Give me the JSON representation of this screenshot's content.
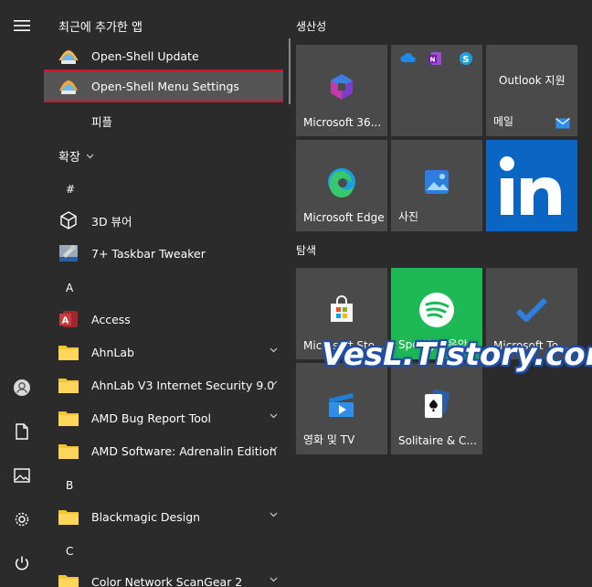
{
  "recent": {
    "header": "최근에 추가한 앱",
    "items": [
      {
        "label": "Open-Shell Update"
      },
      {
        "label": "Open-Shell Menu Settings"
      },
      {
        "label": "피플"
      }
    ]
  },
  "expand_label": "확장",
  "letters": {
    "hash": "#",
    "a": "A",
    "b": "B",
    "c": "C"
  },
  "apps": [
    {
      "label": "3D 뷰어"
    },
    {
      "label": "7+ Taskbar Tweaker"
    },
    {
      "label": "Access"
    },
    {
      "label": "AhnLab"
    },
    {
      "label": "AhnLab V3 Internet Security 9.0"
    },
    {
      "label": "AMD Bug Report Tool"
    },
    {
      "label": "AMD Software: Adrenalin Edition"
    },
    {
      "label": "Blackmagic Design"
    },
    {
      "label": "Color Network ScanGear 2"
    }
  ],
  "groups": {
    "productivity": "생산성",
    "explore": "탐색"
  },
  "tiles": {
    "microsoft365": "Microsoft 36...",
    "outlook_title": "Outlook 지원",
    "mail": "메일",
    "edge": "Microsoft Edge",
    "photos": "사진",
    "store": "Microsoft Sto...",
    "spotify": "Spotify - 음악",
    "todo": "Microsoft To...",
    "movies": "영화 및 TV",
    "solitaire": "Solitaire & C..."
  },
  "watermark": "VesL.Tistory.com",
  "colors": {
    "selection_border": "#d0162a",
    "spotify_green": "#1db954",
    "linkedin_blue": "#0a66c2",
    "tile_bg": "#4a4a4a",
    "folder_yellow": "#f5c433"
  }
}
